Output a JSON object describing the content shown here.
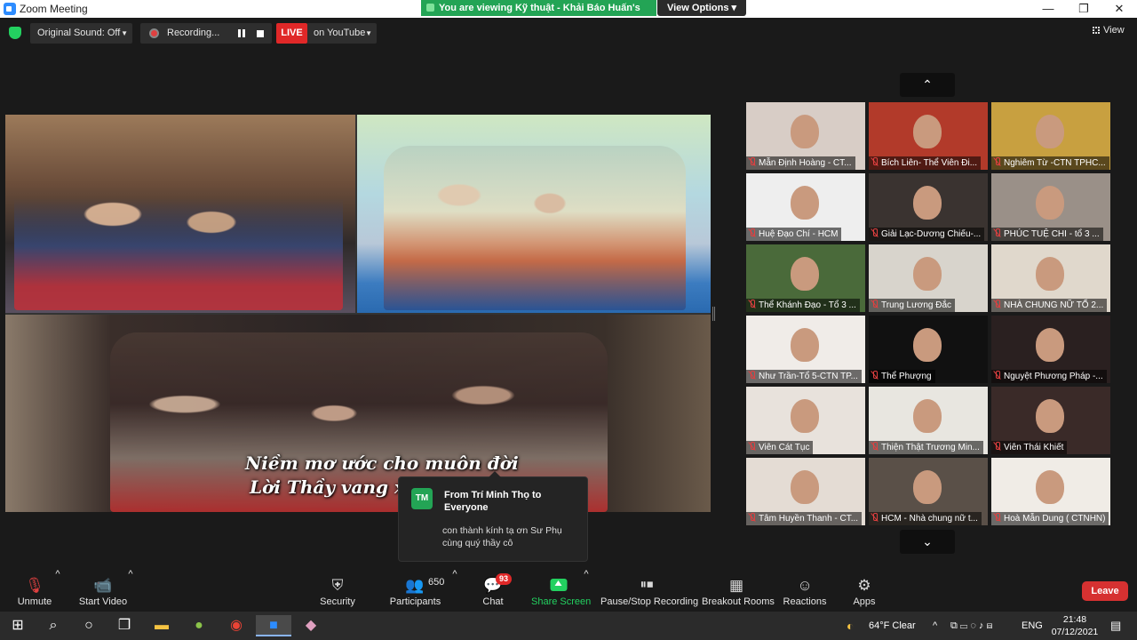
{
  "window": {
    "title": "Zoom Meeting",
    "minimize": "—",
    "maximize": "❐",
    "close": "✕"
  },
  "banner": {
    "viewing": "You are viewing Kỹ thuật - Khải Báo Huấn's screen",
    "view_options": "View Options ▾"
  },
  "topbar": {
    "original_sound": "Original Sound: Off",
    "recording": "Recording...",
    "live": "LIVE",
    "stream_target": "on YouTube",
    "view": "View"
  },
  "shared_screen": {
    "lyric_line1": "Niềm mơ ước cho muôn đời",
    "lyric_line2": "Lời Thầy vang xa n"
  },
  "gallery": {
    "up_icon": "⌃",
    "down_icon": "⌄",
    "participants": [
      {
        "name": "Mẫn Định Hoàng - CT...",
        "bg": "#d8cdc6"
      },
      {
        "name": "Bích Liên- Thể Viên Đi...",
        "bg": "#b23a2a"
      },
      {
        "name": "Nghiêm Từ -CTN TPHC...",
        "bg": "#c8a040"
      },
      {
        "name": "Huệ Đạo Chí - HCM",
        "bg": "#eeeeee"
      },
      {
        "name": "Giải Lạc-Dương Chiếu-...",
        "bg": "#3a3330"
      },
      {
        "name": "PHÚC TUỆ CHI - tổ 3 ...",
        "bg": "#9a9088"
      },
      {
        "name": "Thể Khánh Đạo - Tổ 3 ...",
        "bg": "#4a6a3a"
      },
      {
        "name": "Trung Lương Đắc",
        "bg": "#d8d4cc"
      },
      {
        "name": "NHÀ CHUNG NỮ TỔ 2...",
        "bg": "#e0d8cc"
      },
      {
        "name": "Như Trần-Tổ 5-CTN TP...",
        "bg": "#f0ece8"
      },
      {
        "name": "Thể Phượng",
        "bg": "#111111"
      },
      {
        "name": "Nguyệt Phương Pháp -...",
        "bg": "#2a2020"
      },
      {
        "name": "Viên Cát Tục",
        "bg": "#e8e2dc"
      },
      {
        "name": "Thiện Thật Trương Min...",
        "bg": "#e8e6e0"
      },
      {
        "name": "Viên Thái Khiết",
        "bg": "#3a2a28"
      },
      {
        "name": "Tâm Huyền Thanh - CT...",
        "bg": "#e4dcd4"
      },
      {
        "name": "HCM - Nhà chung nữ t...",
        "bg": "#5a5048"
      },
      {
        "name": "Hoà Mẫn Dung ( CTNHN)",
        "bg": "#f0ece6"
      }
    ]
  },
  "chat_toast": {
    "initials": "TM",
    "from": "From Trí Minh Thọ to Everyone",
    "message": "con thành kính tạ ơn Sư Phụ cùng quý thầy cô"
  },
  "toolbar": {
    "unmute": "Unmute",
    "start_video": "Start Video",
    "security": "Security",
    "participants": "Participants",
    "participant_count": "650",
    "chat": "Chat",
    "chat_badge": "93",
    "share_screen": "Share Screen",
    "pause_stop_recording": "Pause/Stop Recording",
    "breakout_rooms": "Breakout Rooms",
    "reactions": "Reactions",
    "apps": "Apps",
    "leave": "Leave"
  },
  "taskbar": {
    "weather": "64°F  Clear",
    "language": "ENG",
    "time": "21:48",
    "date": "07/12/2021"
  },
  "colors": {
    "accent_green": "#23d160",
    "banner_green": "#23a455",
    "live_red": "#e02828",
    "leave_red": "#d63131"
  }
}
